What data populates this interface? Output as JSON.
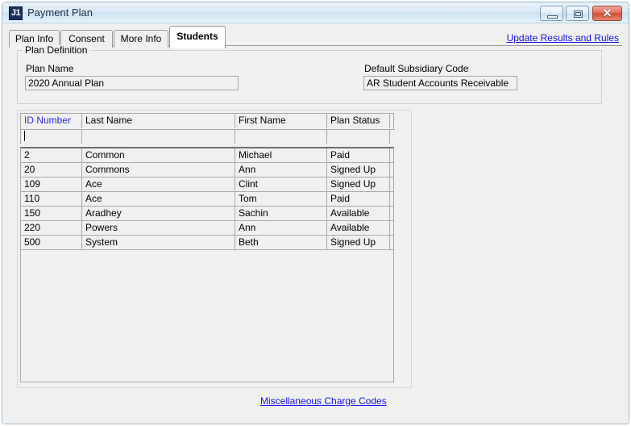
{
  "window": {
    "title": "Payment Plan",
    "icon_label": "J1",
    "controls": {
      "minimize": "minimize-button",
      "maximize": "maximize-button",
      "close": "✕"
    }
  },
  "tabs": [
    {
      "label": "Plan Info",
      "active": false
    },
    {
      "label": "Consent",
      "active": false
    },
    {
      "label": "More Info",
      "active": false
    },
    {
      "label": "Students",
      "active": true
    }
  ],
  "links": {
    "update_results": "Update Results and Rules",
    "misc_charge_codes": "Miscellaneous Charge Codes"
  },
  "plan_definition": {
    "group_label": "Plan Definition",
    "plan_name_label": "Plan Name",
    "plan_name_value": "2020 Annual Plan",
    "plan_name_placeholder": "",
    "subsidiary_label": "Default Subsidiary Code",
    "subsidiary_value": "AR   Student Accounts Receivable",
    "subsidiary_placeholder": ""
  },
  "grid": {
    "columns": [
      {
        "label": "ID Number",
        "sorted": true
      },
      {
        "label": "Last Name",
        "sorted": false
      },
      {
        "label": "First Name",
        "sorted": false
      },
      {
        "label": "Plan Status",
        "sorted": false
      },
      {
        "label": "",
        "sorted": false
      }
    ],
    "filter_row": {
      "id_number": "",
      "last_name": "",
      "first_name": "",
      "plan_status": "",
      "extra": ""
    },
    "rows": [
      {
        "id_number": "2",
        "last_name": "Common",
        "first_name": "Michael",
        "plan_status": "Paid"
      },
      {
        "id_number": "20",
        "last_name": "Commons",
        "first_name": "Ann",
        "plan_status": "Signed Up"
      },
      {
        "id_number": "109",
        "last_name": "Ace",
        "first_name": "Clint",
        "plan_status": "Signed Up"
      },
      {
        "id_number": "110",
        "last_name": "Ace",
        "first_name": "Tom",
        "plan_status": "Paid"
      },
      {
        "id_number": "150",
        "last_name": "Aradhey",
        "first_name": "Sachin",
        "plan_status": "Available"
      },
      {
        "id_number": "220",
        "last_name": "Powers",
        "first_name": "Ann",
        "plan_status": "Available"
      },
      {
        "id_number": "500",
        "last_name": "System",
        "first_name": "Beth",
        "plan_status": "Signed Up"
      }
    ]
  },
  "colors": {
    "link": "#1414ef",
    "sorted_column_header": "#2a2ae0",
    "window_face": "#f0f0f0",
    "title_bar": "#d8eaf6",
    "close_button": "#cf4d33",
    "app_icon": "#1c2f63"
  }
}
